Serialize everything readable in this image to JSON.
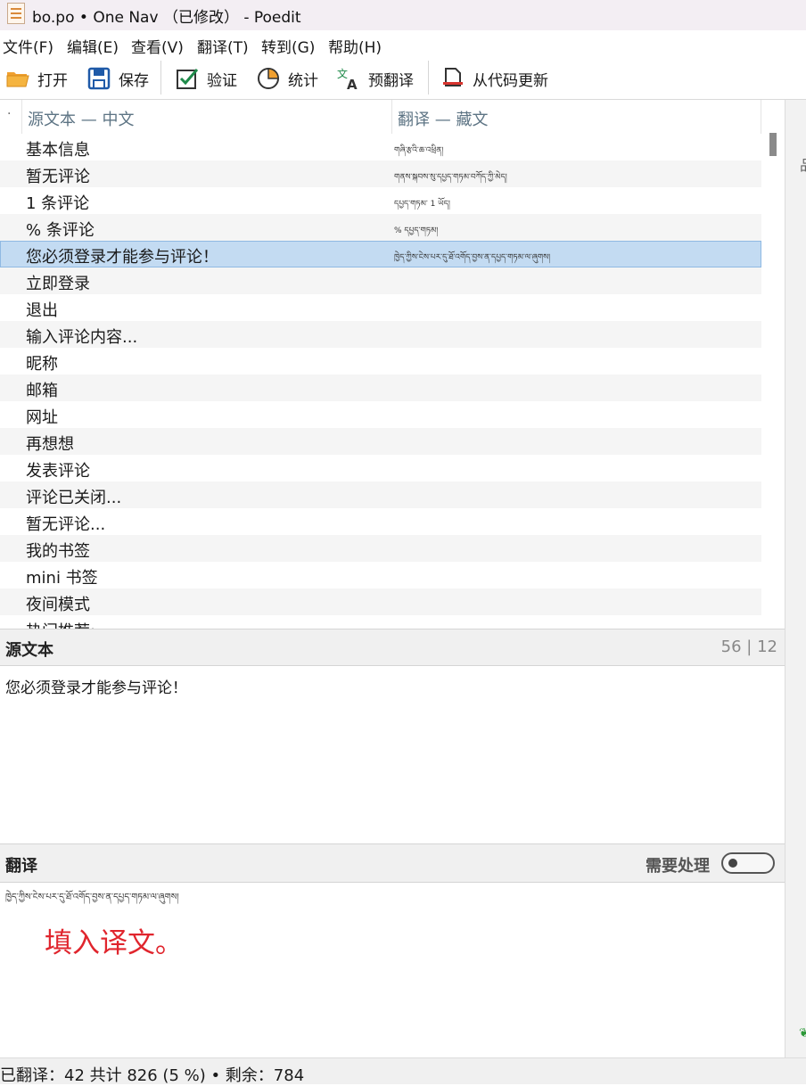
{
  "window": {
    "title": "bo.po • One Nav （已修改） - Poedit"
  },
  "menu": [
    "文件(F)",
    "编辑(E)",
    "查看(V)",
    "翻译(T)",
    "转到(G)",
    "帮助(H)"
  ],
  "toolbar": {
    "open": "打开",
    "save": "保存",
    "validate": "验证",
    "stats": "统计",
    "pretranslate": "预翻译",
    "update_from_code": "从代码更新"
  },
  "list": {
    "col_indicator": "·",
    "col_source": "源文本 — 中文",
    "col_translation": "翻译 — 藏文",
    "rows": [
      {
        "source": "基本信息",
        "translation": "གཞི་རྩའི་ཆ་འཕྲིན།"
      },
      {
        "source": "暂无评论",
        "translation": "གནས་སྐབས་སུ་དཔྱད་གཏམ་བཀོད་ཀྱི་མེད།"
      },
      {
        "source": "1 条评论",
        "translation": "དཔྱད་གཏམ་ 1 ཡོད།"
      },
      {
        "source": "% 条评论",
        "translation": "% དཔྱད་གཏམ།"
      },
      {
        "source": "您必须登录才能参与评论！",
        "translation": "ཁྱེད་ཀྱིས་ངེས་པར་དུ་ཐོ་འགོད་བྱས་ན་དཔྱད་གཏམ་ལ་ཞུགས།"
      },
      {
        "source": "立即登录",
        "translation": ""
      },
      {
        "source": "退出",
        "translation": ""
      },
      {
        "source": "输入评论内容...",
        "translation": ""
      },
      {
        "source": "昵称",
        "translation": ""
      },
      {
        "source": "邮箱",
        "translation": ""
      },
      {
        "source": "网址",
        "translation": ""
      },
      {
        "source": "再想想",
        "translation": ""
      },
      {
        "source": "发表评论",
        "translation": ""
      },
      {
        "source": "评论已关闭...",
        "translation": ""
      },
      {
        "source": "暂无评论...",
        "translation": ""
      },
      {
        "source": "我的书签",
        "translation": ""
      },
      {
        "source": "mini 书签",
        "translation": ""
      },
      {
        "source": "夜间模式",
        "translation": ""
      },
      {
        "source": "热门推荐:",
        "translation": ""
      }
    ],
    "selected_index": 4
  },
  "source_panel": {
    "title": "源文本",
    "counter": "56 | 12",
    "text": "您必须登录才能参与评论！"
  },
  "translation_panel": {
    "title": "翻译",
    "needs_work_label": "需要处理",
    "needs_work": false,
    "text": "ཁྱེད་ཀྱིས་ངེས་པར་དུ་ཐོ་འགོད་བྱས་ན་དཔྱད་གཏམ་ལ་ཞུགས།",
    "hint": "填入译文。"
  },
  "right_panel": {
    "glyph": "品",
    "leaf": "❦"
  },
  "status": {
    "text": "已翻译：42 共计 826 (5 %) • 剩余：784"
  },
  "colors": {
    "selection": "#c3dbf2",
    "header_text": "#5d7484",
    "hint_red": "#e0252d"
  }
}
